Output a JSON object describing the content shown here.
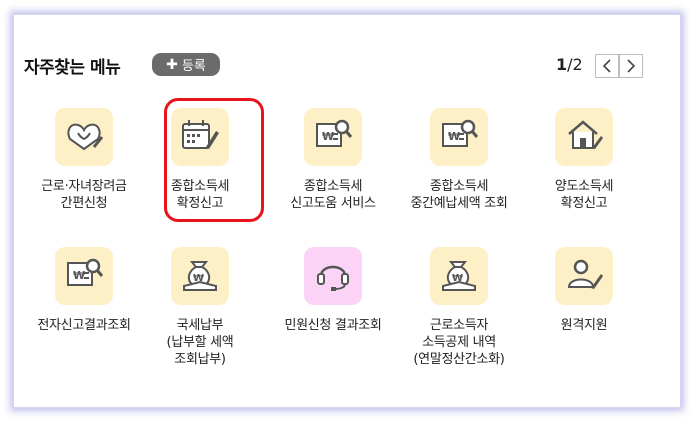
{
  "header": {
    "title": "자주찾는 메뉴",
    "register_label": "등록",
    "page_current": "1",
    "page_total": "/2"
  },
  "colors": {
    "accent_highlight": "#e8141b",
    "icon_bg": "#fdf0c6",
    "icon_bg_alt": "#fbd3f7"
  },
  "menu_items": [
    {
      "lines": [
        "근로·자녀장려금",
        "간편신청"
      ],
      "icon": "heart-hands-icon"
    },
    {
      "lines": [
        "종합소득세",
        "확정신고"
      ],
      "icon": "calendar-pen-icon",
      "highlighted": true
    },
    {
      "lines": [
        "종합소득세",
        "신고도움 서비스"
      ],
      "icon": "document-search-icon"
    },
    {
      "lines": [
        "종합소득세",
        "중간예납세액 조회"
      ],
      "icon": "document-search-icon"
    },
    {
      "lines": [
        "양도소득세",
        "확정신고"
      ],
      "icon": "house-icon"
    },
    {
      "lines": [
        "전자신고결과조회"
      ],
      "icon": "document-search-icon"
    },
    {
      "lines": [
        "국세납부",
        "(납부할 세액",
        "조회납부)"
      ],
      "icon": "money-bag-icon"
    },
    {
      "lines": [
        "민원신청 결과조회"
      ],
      "icon": "headset-icon"
    },
    {
      "lines": [
        "근로소득자",
        "소득공제 내역",
        "(연말정산간소화)"
      ],
      "icon": "money-bag-icon"
    },
    {
      "lines": [
        "원격지원"
      ],
      "icon": "person-pen-icon"
    }
  ]
}
